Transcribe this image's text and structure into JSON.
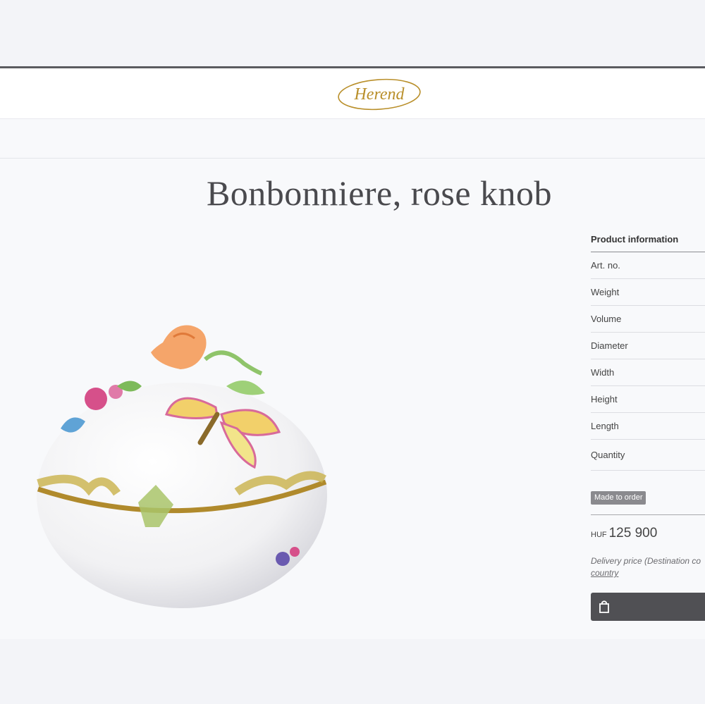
{
  "brand": {
    "logo_text": "Herend",
    "logo_color": "#b98f2a"
  },
  "product": {
    "title": "Bonbonniere, rose knob",
    "image_icon": "rose-knob-bonbonniere-image"
  },
  "info": {
    "heading": "Product information",
    "rows": [
      "Art. no.",
      "Weight",
      "Volume",
      "Diameter",
      "Width",
      "Height",
      "Length"
    ],
    "quantity_label": "Quantity"
  },
  "availability": {
    "badge": "Made to order"
  },
  "price": {
    "currency": "HUF",
    "amount": "125 900"
  },
  "delivery": {
    "text": "Delivery price (Destination co",
    "link": "country"
  },
  "cart": {
    "icon": "shopping-bag-icon",
    "button_color": "#505054"
  }
}
